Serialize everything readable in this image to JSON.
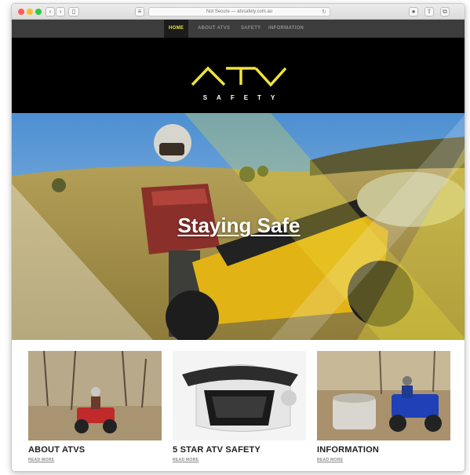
{
  "browser": {
    "url": "Not Secure — atvsafety.com.au",
    "reload_icon": "↻"
  },
  "nav": {
    "items": [
      {
        "label": "HOME",
        "active": true
      },
      {
        "label": "ABOUT ATVS",
        "active": false
      },
      {
        "label": "SAFETY",
        "active": false
      },
      {
        "label": "INFORMATION",
        "active": false
      }
    ]
  },
  "header": {
    "logo_mark": "ATV",
    "logo_sub": "SAFETY",
    "logo_color": "#f0e33c"
  },
  "hero": {
    "title": "Staying Safe",
    "overlay_color": "#f0e33c"
  },
  "cards": [
    {
      "title": "ABOUT ATVS",
      "link": "READ MORE"
    },
    {
      "title": "5 STAR ATV SAFETY",
      "link": "READ MORE"
    },
    {
      "title": "INFORMATION",
      "link": "READ MORE"
    }
  ]
}
